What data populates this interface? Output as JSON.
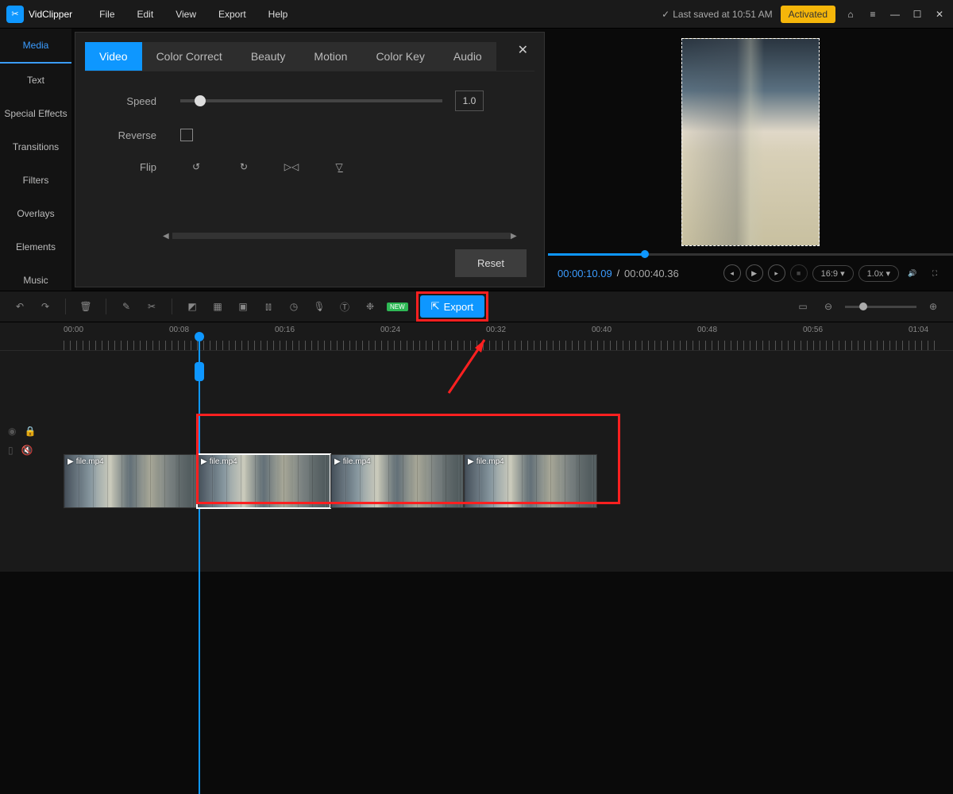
{
  "app": {
    "name": "VidClipper"
  },
  "menu": {
    "file": "File",
    "edit": "Edit",
    "view": "View",
    "export": "Export",
    "help": "Help"
  },
  "status": {
    "saved": "Last saved at 10:51 AM",
    "activated": "Activated"
  },
  "sidebar": {
    "media": "Media",
    "text": "Text",
    "sfx": "Special Effects",
    "transitions": "Transitions",
    "filters": "Filters",
    "overlays": "Overlays",
    "elements": "Elements",
    "music": "Music"
  },
  "editTabs": {
    "video": "Video",
    "color": "Color Correct",
    "beauty": "Beauty",
    "motion": "Motion",
    "colorkey": "Color Key",
    "audio": "Audio"
  },
  "videoPanel": {
    "speed": "Speed",
    "speedVal": "1.0",
    "reverse": "Reverse",
    "flip": "Flip",
    "reset": "Reset"
  },
  "preview": {
    "current": "00:00:10.09",
    "sep": "/",
    "total": "00:00:40.36",
    "aspect": "16:9",
    "playback": "1.0x"
  },
  "toolbar": {
    "export": "Export",
    "new": "NEW"
  },
  "ruler": {
    "t0": "00:00",
    "t1": "00:08",
    "t2": "00:16",
    "t3": "00:24",
    "t4": "00:32",
    "t5": "00:40",
    "t6": "00:48",
    "t7": "00:56",
    "t8": "01:04"
  },
  "clips": {
    "name": "file.mp4"
  }
}
